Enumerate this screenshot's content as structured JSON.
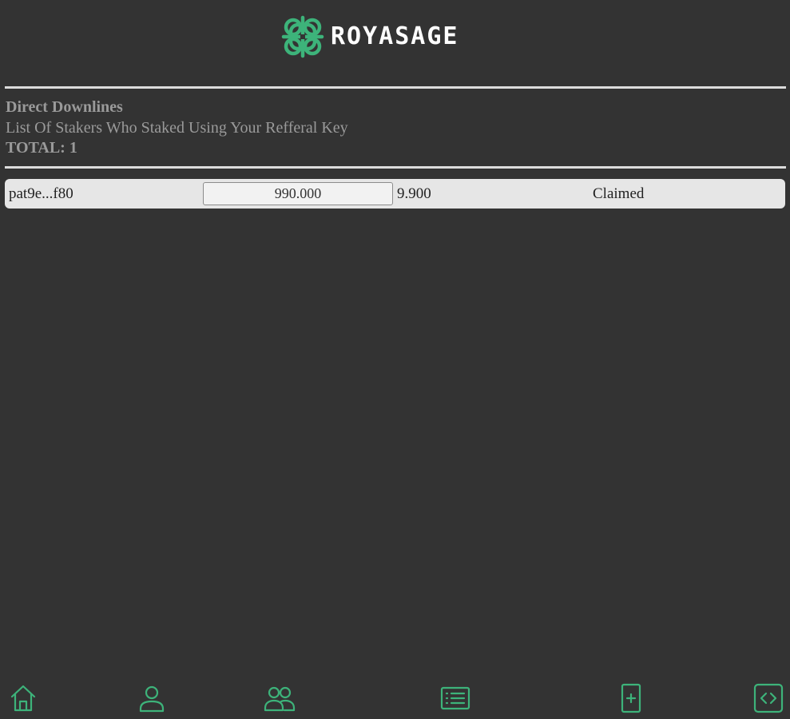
{
  "brand": {
    "name": "ROYASAGE",
    "logo_icon": "celtic-knot-icon",
    "accent_color": "#3db37a"
  },
  "section": {
    "title": "Direct Downlines",
    "subtitle": "List Of Stakers Who Staked Using Your Refferal Key",
    "total": "TOTAL: 1"
  },
  "downlines": [
    {
      "address": "pat9e...f80",
      "amount": "990.000",
      "reward": "9.900",
      "status": "Claimed"
    }
  ],
  "bottom_nav": [
    {
      "name": "home",
      "icon": "home-icon"
    },
    {
      "name": "profile",
      "icon": "user-icon"
    },
    {
      "name": "downlines",
      "icon": "users-icon"
    },
    {
      "name": "stakes-list",
      "icon": "list-icon"
    },
    {
      "name": "new-stake",
      "icon": "add-document-icon"
    },
    {
      "name": "developer",
      "icon": "code-icon"
    }
  ]
}
